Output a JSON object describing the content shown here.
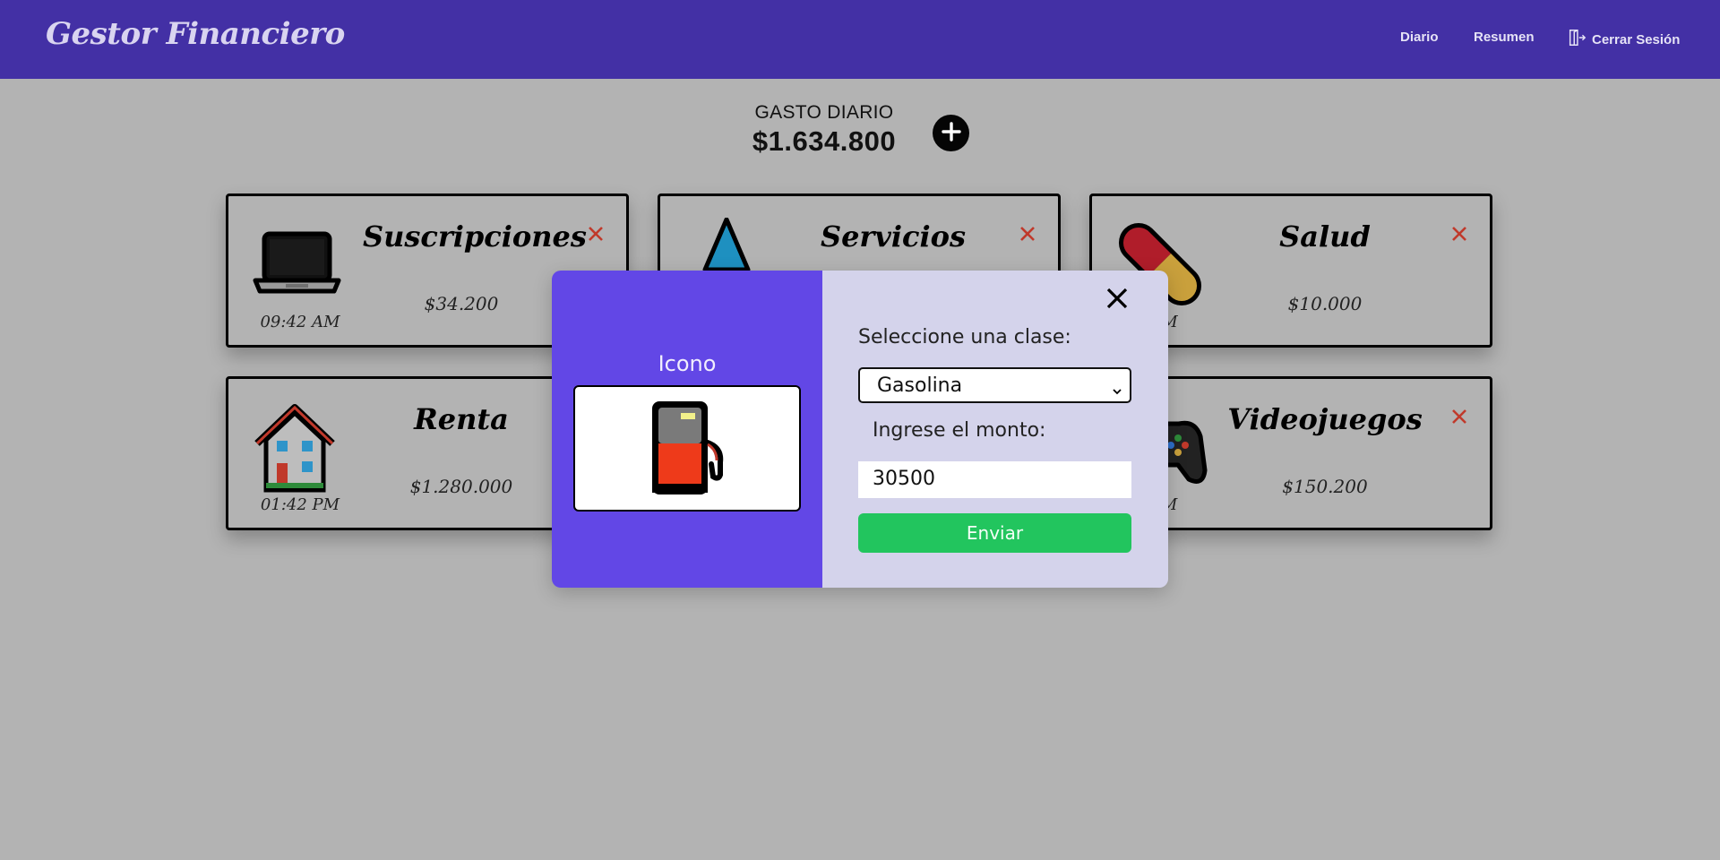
{
  "app": {
    "brand": "Gestor Financiero",
    "nav": {
      "diario": "Diario",
      "resumen": "Resumen",
      "logout": "Cerrar Sesión"
    }
  },
  "summary": {
    "label": "GASTO DIARIO",
    "total": "$1.634.800"
  },
  "cards": [
    {
      "title": "Suscripciones",
      "amount": "$34.200",
      "time": "09:42 AM",
      "icon": "laptop-icon"
    },
    {
      "title": "Servicios",
      "amount": "",
      "time": "",
      "icon": "water-drop-icon"
    },
    {
      "title": "Salud",
      "amount": "$10.000",
      "time": "AM",
      "icon": "pill-icon"
    },
    {
      "title": "Renta",
      "amount": "$1.280.000",
      "time": "01:42 PM",
      "icon": "house-icon"
    },
    {
      "title": "",
      "amount": "",
      "time": "",
      "icon": ""
    },
    {
      "title": "Videojuegos",
      "amount": "$150.200",
      "time": "PM",
      "icon": "gamepad-icon"
    }
  ],
  "modal": {
    "icon_label": "Icono",
    "icon": "fuel-pump-icon",
    "class_label": "Seleccione una clase:",
    "class_value": "Gasolina",
    "amount_label": "Ingrese el monto:",
    "amount_value": "30500",
    "submit_label": "Enviar"
  },
  "colors": {
    "navbar": "#4330a5",
    "background": "#b3b3b3",
    "modal_left": "#6247e6",
    "modal_right": "#d4d3eb",
    "submit": "#22c55e",
    "delete": "#c0392b"
  }
}
